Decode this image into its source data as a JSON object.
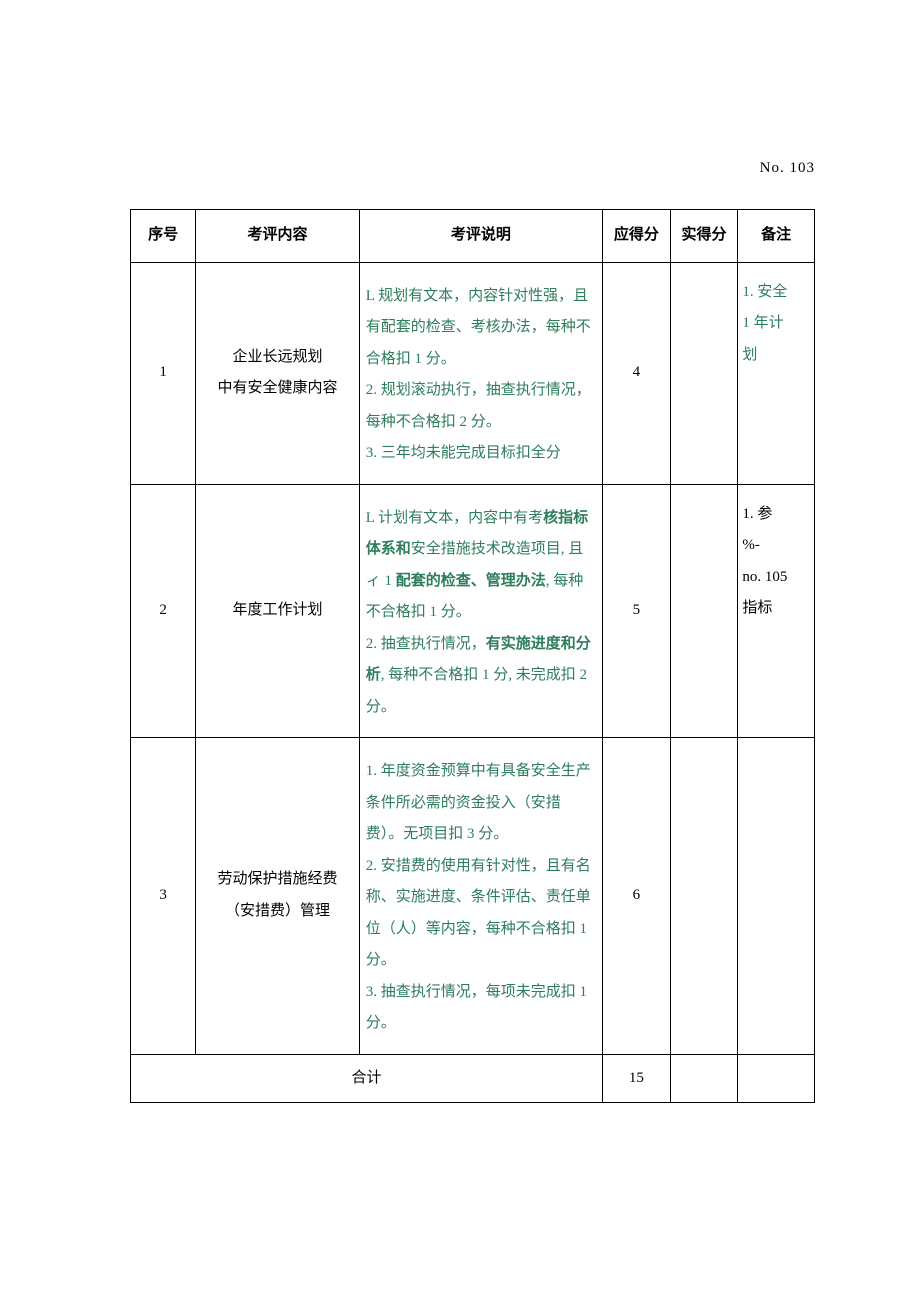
{
  "page_number": "No. 103",
  "headers": {
    "idx": "序号",
    "item": "考评内容",
    "desc": "考评说明",
    "due": "应得分",
    "got": "实得分",
    "note": "备注"
  },
  "rows": [
    {
      "idx": "1",
      "item_line1": "企业长远规划",
      "item_line2": "中有安全健康内容",
      "desc_pre_1": "  L 规划有文本，内容针对性强，且有配套的检查、考核办法，每种不合格扣 1 分。",
      "desc_pre_2": "  2. 规划滚动执行，抽查执行情况，每种不合格扣 2 分。",
      "desc_pre_3": "  3. 三年均未能完成目标扣全分",
      "due": "4",
      "got": "",
      "note_l1": "1. 安全",
      "note_l2": "1 年计",
      "note_l3": "划"
    },
    {
      "idx": "2",
      "item": "年度工作计划",
      "p1_a": "  L 计划有文本，内容中有考",
      "p1_b": "核指标体系和",
      "p1_c": "安全措施技术改造项目, 且ィ 1",
      "p1_d": " 配套的检查、管理办法",
      "p1_e": ", 每种不合格扣 1 分。",
      "p2_a": "  2. 抽查执行情况，",
      "p2_b": "有实施进度和分析",
      "p2_c": ", 每种不合格扣 1 分, 未完成扣 2 分。",
      "due": "5",
      "got": "",
      "note_l1": "1. 参",
      "note_l2": "%-",
      "note_l3": "no. 105",
      "note_l4": "指标"
    },
    {
      "idx": "3",
      "item_line1": "劳动保护措施经费",
      "item_line2": "（安措费）管理",
      "d1": "  1. 年度资金预算中有具备安全生产条件所必需的资金投入（安措费）。无项目扣 3 分。",
      "d2": "  2. 安措费的使用有针对性，且有名称、实施进度、条件评估、责任单位（人）等内容，每种不合格扣 1 分。",
      "d3": "  3. 抽查执行情况，每项未完成扣 1 分。",
      "due": "6",
      "got": "",
      "note": ""
    }
  ],
  "total": {
    "label": "合计",
    "due": "15",
    "got": "",
    "note": ""
  }
}
